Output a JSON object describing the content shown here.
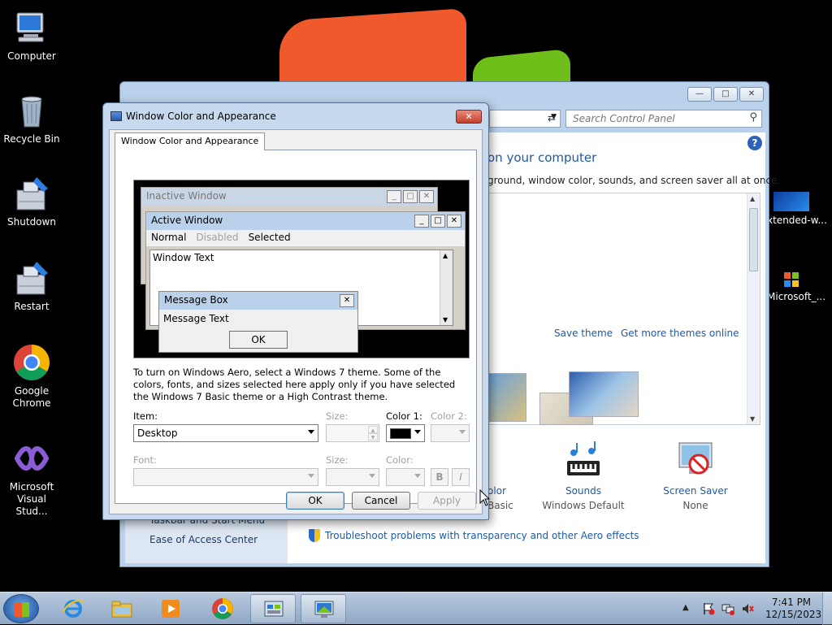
{
  "desktop": {
    "icons": [
      {
        "label": "Computer",
        "icon": "computer-icon"
      },
      {
        "label": "Recycle Bin",
        "icon": "recycle-bin-icon"
      },
      {
        "label": "Shutdown",
        "icon": "shutdown-icon"
      },
      {
        "label": "Restart",
        "icon": "restart-icon"
      },
      {
        "label": "Google Chrome",
        "icon": "chrome-icon"
      },
      {
        "label": "Microsoft Visual Stud...",
        "icon": "visual-studio-icon"
      }
    ],
    "right_icons": [
      {
        "label": "xtended-w...",
        "icon": "extended-wallpaper-icon"
      },
      {
        "label": "Microsoft_...",
        "icon": "microsoft-icon"
      }
    ]
  },
  "control_panel": {
    "search_placeholder": "Search Control Panel",
    "heading": "on your computer",
    "subheading": "ground, window color, sounds, and screen saver all at once.",
    "save_theme": "Save theme",
    "more_themes": "Get more themes online",
    "bottom_items": [
      {
        "label": "olor",
        "sub": "Basic",
        "icon": "window-color-icon"
      },
      {
        "label": "Sounds",
        "sub": "Windows Default",
        "icon": "sounds-icon"
      },
      {
        "label": "Screen Saver",
        "sub": "None",
        "icon": "screen-saver-icon"
      }
    ],
    "left_links": [
      "Taskbar and Start Menu",
      "Ease of Access Center"
    ],
    "troubleshoot": "Troubleshoot problems with transparency and other Aero effects"
  },
  "dialog": {
    "title": "Window Color and Appearance",
    "tab": "Window Color and Appearance",
    "preview": {
      "inactive_title": "Inactive Window",
      "active_title": "Active Window",
      "menu": {
        "normal": "Normal",
        "disabled": "Disabled",
        "selected": "Selected"
      },
      "window_text": "Window Text",
      "message_box_title": "Message Box",
      "message_text": "Message Text",
      "ok": "OK"
    },
    "description": "To turn on Windows Aero, select a Windows 7 theme.  Some of the colors, fonts, and sizes selected here apply only if you have selected the Windows 7 Basic theme or a High Contrast theme.",
    "item_label": "Item:",
    "item_value": "Desktop",
    "size_label": "Size:",
    "color1_label": "Color 1:",
    "color1_value": "#000000",
    "color2_label": "Color 2:",
    "font_label": "Font:",
    "font_size_label": "Size:",
    "font_color_label": "Color:",
    "bold": "B",
    "italic": "I",
    "ok": "OK",
    "cancel": "Cancel",
    "apply": "Apply"
  },
  "taskbar": {
    "items": [
      {
        "icon": "internet-explorer-icon",
        "open": false
      },
      {
        "icon": "file-explorer-icon",
        "open": false
      },
      {
        "icon": "media-player-icon",
        "open": false
      },
      {
        "icon": "chrome-icon",
        "open": false
      },
      {
        "icon": "control-panel-icon",
        "open": true
      },
      {
        "icon": "display-settings-icon",
        "open": true
      }
    ],
    "time": "7:41 PM",
    "date": "12/15/2023"
  }
}
